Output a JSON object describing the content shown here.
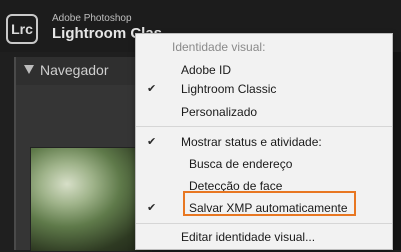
{
  "app": {
    "logo_text": "Lrc",
    "brand_top": "Adobe Photoshop",
    "brand_main": "Lightroom Clas"
  },
  "left_panel": {
    "title": "Navegador"
  },
  "menu": {
    "section_label": "Identidade visual:",
    "items": [
      {
        "label": "Adobe ID",
        "checked": false
      },
      {
        "label": "Lightroom Classic",
        "checked": true
      },
      {
        "label": "Personalizado",
        "checked": false
      }
    ],
    "status_item": {
      "label": "Mostrar status e atividade:",
      "checked": true
    },
    "sub_items": [
      {
        "label": "Busca de endereço",
        "checked": false
      },
      {
        "label": "Detecção de face",
        "checked": false
      },
      {
        "label": "Salvar XMP automaticamente",
        "checked": true
      }
    ],
    "edit_item": {
      "label": "Editar identidade visual..."
    }
  },
  "colors": {
    "highlight": "#e87722",
    "menu_bg": "#f2f2f2",
    "app_bg": "#1f1f1f"
  }
}
